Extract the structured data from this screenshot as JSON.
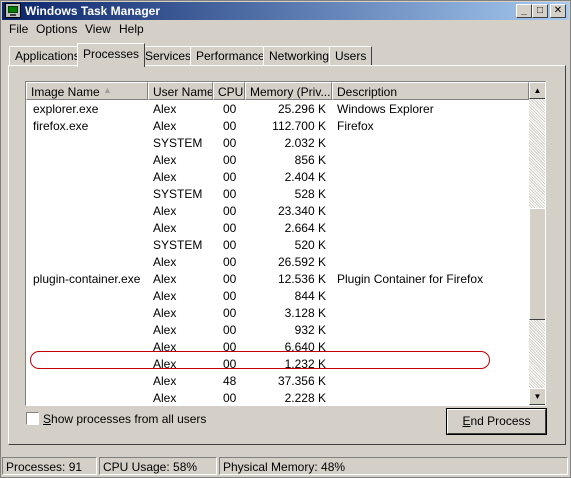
{
  "window": {
    "title": "Windows Task Manager",
    "icon": "task-manager-icon"
  },
  "titlebar_buttons": {
    "minimize": "_",
    "maximize": "□",
    "close": "✕"
  },
  "menu": [
    "File",
    "Options",
    "View",
    "Help"
  ],
  "tabs": [
    {
      "label": "Applications",
      "active": false
    },
    {
      "label": "Processes",
      "active": true
    },
    {
      "label": "Services",
      "active": false
    },
    {
      "label": "Performance",
      "active": false
    },
    {
      "label": "Networking",
      "active": false
    },
    {
      "label": "Users",
      "active": false
    }
  ],
  "columns": {
    "name": "Image Name",
    "user": "User Name",
    "cpu": "CPU",
    "memory": "Memory (Priv...",
    "description": "Description"
  },
  "rows": [
    {
      "name": "explorer.exe",
      "user": "Alex",
      "cpu": "00",
      "memory": "25.296 K",
      "description": "Windows Explorer"
    },
    {
      "name": "firefox.exe",
      "user": "Alex",
      "cpu": "00",
      "memory": "112.700 K",
      "description": "Firefox"
    },
    {
      "name": "",
      "user": "SYSTEM",
      "cpu": "00",
      "memory": "2.032 K",
      "description": ""
    },
    {
      "name": "",
      "user": "Alex",
      "cpu": "00",
      "memory": "856 K",
      "description": ""
    },
    {
      "name": "",
      "user": "Alex",
      "cpu": "00",
      "memory": "2.404 K",
      "description": ""
    },
    {
      "name": "",
      "user": "SYSTEM",
      "cpu": "00",
      "memory": "528 K",
      "description": ""
    },
    {
      "name": "",
      "user": "Alex",
      "cpu": "00",
      "memory": "23.340 K",
      "description": ""
    },
    {
      "name": "",
      "user": "Alex",
      "cpu": "00",
      "memory": "2.664 K",
      "description": ""
    },
    {
      "name": "",
      "user": "SYSTEM",
      "cpu": "00",
      "memory": "520 K",
      "description": ""
    },
    {
      "name": "",
      "user": "Alex",
      "cpu": "00",
      "memory": "26.592 K",
      "description": ""
    },
    {
      "name": "plugin-container.exe",
      "user": "Alex",
      "cpu": "00",
      "memory": "12.536 K",
      "description": "Plugin Container for Firefox",
      "highlighted": true
    },
    {
      "name": "",
      "user": "Alex",
      "cpu": "00",
      "memory": "844 K",
      "description": ""
    },
    {
      "name": "",
      "user": "Alex",
      "cpu": "00",
      "memory": "3.128 K",
      "description": ""
    },
    {
      "name": "",
      "user": "Alex",
      "cpu": "00",
      "memory": "932 K",
      "description": ""
    },
    {
      "name": "",
      "user": "Alex",
      "cpu": "00",
      "memory": "6.640 K",
      "description": ""
    },
    {
      "name": "",
      "user": "Alex",
      "cpu": "00",
      "memory": "1.232 K",
      "description": ""
    },
    {
      "name": "",
      "user": "Alex",
      "cpu": "48",
      "memory": "37.356 K",
      "description": ""
    },
    {
      "name": "",
      "user": "Alex",
      "cpu": "00",
      "memory": "2.228 K",
      "description": ""
    }
  ],
  "show_all_users": {
    "label_accel": "S",
    "label_rest": "how processes from all users",
    "checked": false
  },
  "end_process": {
    "label_accel": "E",
    "label_rest": "nd Process"
  },
  "status": {
    "processes": "Processes: 91",
    "cpu": "CPU Usage: 58%",
    "memory": "Physical Memory: 48%"
  },
  "colors": {
    "title_start": "#0a246a",
    "title_end": "#a6caf0",
    "highlight_outline": "#c00000"
  }
}
